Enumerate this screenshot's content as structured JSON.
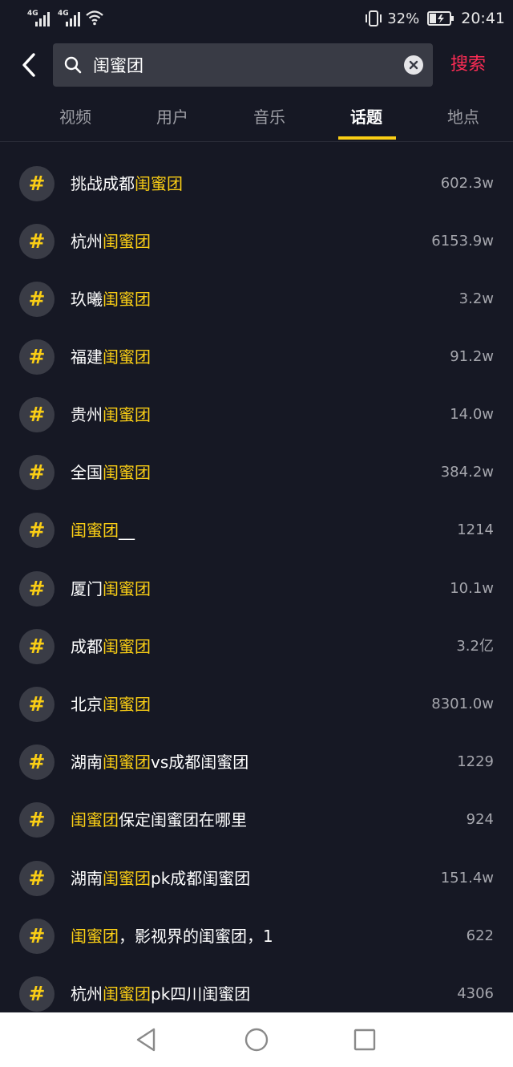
{
  "status": {
    "signal1": "4G",
    "signal2": "4G",
    "battery_percent": "32%",
    "time": "20:41"
  },
  "search": {
    "query": "闺蜜团",
    "submit_label": "搜索"
  },
  "tabs": [
    {
      "label": "视频"
    },
    {
      "label": "用户"
    },
    {
      "label": "音乐"
    },
    {
      "label": "话题"
    },
    {
      "label": "地点"
    }
  ],
  "active_tab": "话题",
  "hashtag_icon": "#",
  "highlight_color": "#face15",
  "topics": [
    {
      "pre": "挑战成都",
      "hl": "闺蜜团",
      "post": "",
      "count": "602.3w"
    },
    {
      "pre": "杭州",
      "hl": "闺蜜团",
      "post": "",
      "count": "6153.9w"
    },
    {
      "pre": "玖曦",
      "hl": "闺蜜团",
      "post": "",
      "count": "3.2w"
    },
    {
      "pre": "福建",
      "hl": "闺蜜团",
      "post": "",
      "count": "91.2w"
    },
    {
      "pre": "贵州",
      "hl": "闺蜜团",
      "post": "",
      "count": "14.0w"
    },
    {
      "pre": "全国",
      "hl": "闺蜜团",
      "post": "",
      "count": "384.2w"
    },
    {
      "pre": "",
      "hl": "闺蜜团",
      "post": "__",
      "count": "1214"
    },
    {
      "pre": "厦门",
      "hl": "闺蜜团",
      "post": "",
      "count": "10.1w"
    },
    {
      "pre": "成都",
      "hl": "闺蜜团",
      "post": "",
      "count": "3.2亿"
    },
    {
      "pre": "北京",
      "hl": "闺蜜团",
      "post": "",
      "count": "8301.0w"
    },
    {
      "pre": "湖南",
      "hl": "闺蜜团",
      "post": "vs成都闺蜜团",
      "count": "1229"
    },
    {
      "pre": "",
      "hl": "闺蜜团",
      "post": "保定闺蜜团在哪里",
      "count": "924"
    },
    {
      "pre": "湖南",
      "hl": "闺蜜团",
      "post": "pk成都闺蜜团",
      "count": "151.4w"
    },
    {
      "pre": "",
      "hl": "闺蜜团",
      "post": "，影视界的闺蜜团，1",
      "count": "622"
    },
    {
      "pre": "杭州",
      "hl": "闺蜜团",
      "post": "pk四川闺蜜团",
      "count": "4306"
    }
  ],
  "nav": {
    "back": "back-triangle-icon",
    "home": "home-circle-icon",
    "recents": "recents-square-icon"
  }
}
